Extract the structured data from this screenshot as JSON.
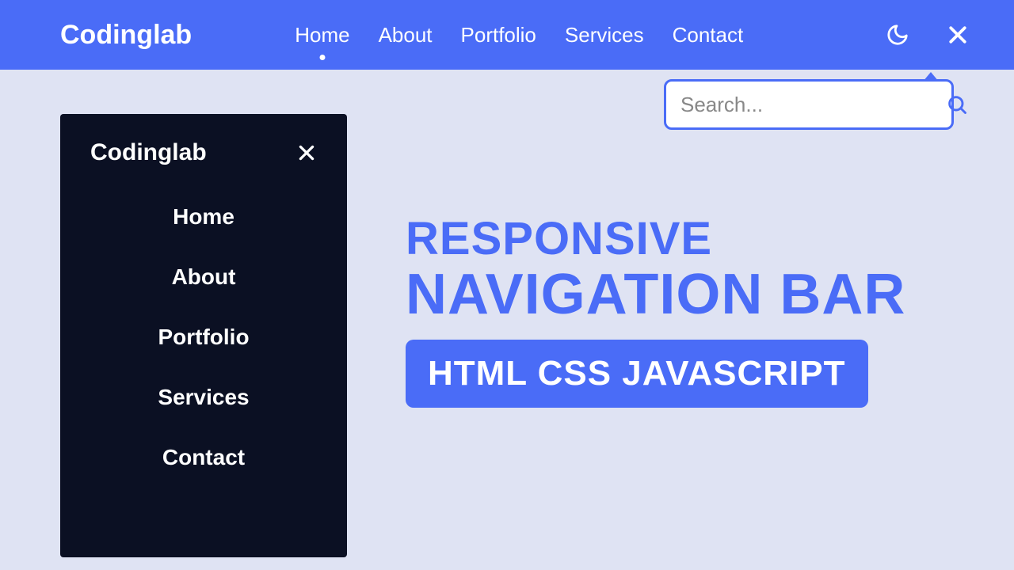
{
  "brand": "Codinglab",
  "nav": {
    "items": [
      "Home",
      "About",
      "Portfolio",
      "Services",
      "Contact"
    ],
    "active_index": 0
  },
  "search": {
    "placeholder": "Search...",
    "value": ""
  },
  "sidebar": {
    "brand": "Codinglab",
    "items": [
      "Home",
      "About",
      "Portfolio",
      "Services",
      "Contact"
    ]
  },
  "hero": {
    "line1": "RESPONSIVE",
    "line2": "NAVIGATION BAR",
    "pill": "HTML CSS JAVASCRIPT"
  },
  "colors": {
    "primary": "#4a6cf7",
    "page_bg": "#dfe3f3",
    "sidebar_bg": "#0b1023"
  },
  "icons": {
    "moon": "moon-icon",
    "close": "close-icon",
    "search": "search-icon"
  }
}
